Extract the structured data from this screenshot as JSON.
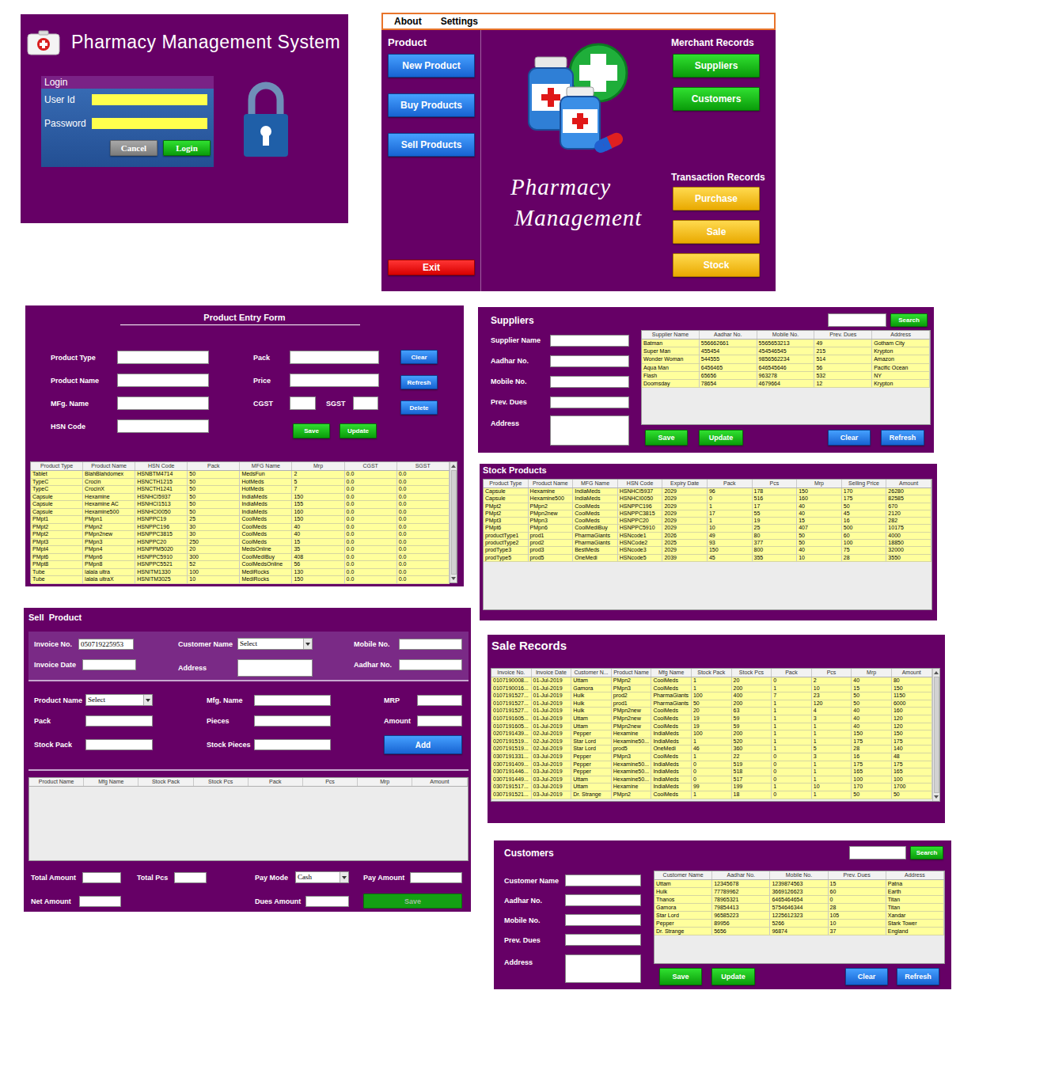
{
  "login": {
    "title": "Pharmacy Management System",
    "box_title": "Login",
    "fields": [
      "User Id",
      "Password"
    ],
    "buttons": [
      "Cancel",
      "Login"
    ]
  },
  "main": {
    "menu": [
      "About",
      "Settings"
    ],
    "product_heading": "Product",
    "product_buttons": [
      "New Product",
      "Buy Products",
      "Sell Products"
    ],
    "exit": "Exit",
    "logo_lines": [
      "Pharmacy",
      "Management"
    ],
    "merchant_heading": "Merchant Records",
    "merchant_buttons": [
      "Suppliers",
      "Customers"
    ],
    "transaction_heading": "Transaction Records",
    "transaction_buttons": [
      "Purchase",
      "Sale",
      "Stock"
    ]
  },
  "product_form": {
    "title": "Product Entry Form",
    "left_fields": [
      "Product Type",
      "Product Name",
      "MFg. Name",
      "HSN Code"
    ],
    "pack": "Pack",
    "price": "Price",
    "cgst": "CGST",
    "sgst": "SGST",
    "side_buttons": [
      "Clear",
      "Refresh",
      "Delete"
    ],
    "buttons": [
      "Save",
      "Update"
    ],
    "table": {
      "columns": [
        "Product Type",
        "Product Name",
        "HSN Code",
        "Pack",
        "MFG Name",
        "Mrp",
        "CGST",
        "SGST"
      ],
      "rows": [
        [
          "Tablet",
          "BlahBlahdomex",
          "HSNBTM4714",
          "50",
          "MedsFun",
          "2",
          "0.0",
          "0.0"
        ],
        [
          "TypeC",
          "Crocin",
          "HSNCTH1215",
          "50",
          "HotMeds",
          "5",
          "0.0",
          "0.0"
        ],
        [
          "TypeC",
          "CrocinX",
          "HSNCTH1241",
          "50",
          "HotMeds",
          "7",
          "0.0",
          "0.0"
        ],
        [
          "Capsule",
          "Hexamine",
          "HSNHCI5937",
          "50",
          "IndiaMeds",
          "150",
          "0.0",
          "0.0"
        ],
        [
          "Capsule",
          "Hexamine AC",
          "HSNHCI1513",
          "50",
          "IndiaMeds",
          "155",
          "0.0",
          "0.0"
        ],
        [
          "Capsule",
          "Hexamine500",
          "HSNHCI0050",
          "50",
          "IndiaMeds",
          "160",
          "0.0",
          "0.0"
        ],
        [
          "PMpt1",
          "PMpn1",
          "HSNPPC19",
          "25",
          "CoolMeds",
          "150",
          "0.0",
          "0.0"
        ],
        [
          "PMpt2",
          "PMpn2",
          "HSNPPC196",
          "30",
          "CoolMeds",
          "40",
          "0.0",
          "0.0"
        ],
        [
          "PMpt2",
          "PMpn2new",
          "HSNPPC3815",
          "30",
          "CoolMeds",
          "40",
          "0.0",
          "0.0"
        ],
        [
          "PMpt3",
          "PMpn3",
          "HSNPPC20",
          "250",
          "CoolMeds",
          "15",
          "0.0",
          "0.0"
        ],
        [
          "PMpt4",
          "PMpn4",
          "HSNPPM5020",
          "20",
          "MedsOnline",
          "35",
          "0.0",
          "0.0"
        ],
        [
          "PMpt6",
          "PMpn6",
          "HSNPPC5910",
          "300",
          "CoolMediBuy",
          "408",
          "0.0",
          "0.0"
        ],
        [
          "PMpt8",
          "PMpn8",
          "HSNPPC5521",
          "52",
          "CoolMedsOnline",
          "56",
          "0.0",
          "0.0"
        ],
        [
          "Tube",
          "lalala ultra",
          "HSNITM1330",
          "100",
          "MediRocks",
          "130",
          "0.0",
          "0.0"
        ],
        [
          "Tube",
          "lalala ultraX",
          "HSNITM3025",
          "10",
          "MediRocks",
          "150",
          "0.0",
          "0.0"
        ]
      ]
    }
  },
  "suppliers": {
    "title": "Suppliers",
    "search_button": "Search",
    "fields": [
      "Supplier Name",
      "Aadhar No.",
      "Mobile No.",
      "Prev. Dues",
      "Address"
    ],
    "buttons": [
      "Save",
      "Update",
      "Clear",
      "Refresh"
    ],
    "table": {
      "columns": [
        "Supplier Name",
        "Aadhar No.",
        "Mobile No.",
        "Prev. Dues",
        "Address"
      ],
      "rows": [
        [
          "Batman",
          "556662661",
          "5565653213",
          "49",
          "Gotham City"
        ],
        [
          "Super Man",
          "455454",
          "454546545",
          "215",
          "Krypton"
        ],
        [
          "Wonder Woman",
          "544555",
          "9856562234",
          "514",
          "Amazon"
        ],
        [
          "Aqua Man",
          "6456465",
          "646545646",
          "56",
          "Pacific Ocean"
        ],
        [
          "Flash",
          "65656",
          "963278",
          "532",
          "NY"
        ],
        [
          "Doomsday",
          "78654",
          "4679664",
          "12",
          "Krypton"
        ]
      ]
    }
  },
  "stock": {
    "title": "Stock Products",
    "table": {
      "columns": [
        "Product Type",
        "Product Name",
        "MFG Name",
        "HSN Code",
        "Expiry Date",
        "Pack",
        "Pcs",
        "Mrp",
        "Selling Price",
        "Amount"
      ],
      "rows": [
        [
          "Capsule",
          "Hexamine",
          "IndiaMeds",
          "HSNHCI5937",
          "2029",
          "96",
          "178",
          "150",
          "170",
          "26280"
        ],
        [
          "Capsule",
          "Hexamine500",
          "IndiaMeds",
          "HSNHCI0050",
          "2029",
          "0",
          "516",
          "160",
          "175",
          "82585"
        ],
        [
          "PMpt2",
          "PMpn2",
          "CoolMeds",
          "HSNPPC196",
          "2029",
          "1",
          "17",
          "40",
          "50",
          "670"
        ],
        [
          "PMpt2",
          "PMpn2new",
          "CoolMeds",
          "HSNPPC3815",
          "2029",
          "17",
          "55",
          "40",
          "45",
          "2120"
        ],
        [
          "PMpt3",
          "PMpn3",
          "CoolMeds",
          "HSNPPC20",
          "2029",
          "1",
          "19",
          "15",
          "16",
          "282"
        ],
        [
          "PMpt6",
          "PMpn6",
          "CoolMediBuy",
          "HSNPPC5910",
          "2029",
          "10",
          "25",
          "407",
          "500",
          "10175"
        ],
        [
          "productType1",
          "prod1",
          "PharmaGiants",
          "HSNcode1",
          "2026",
          "49",
          "80",
          "50",
          "60",
          "4000"
        ],
        [
          "productType2",
          "prod2",
          "PharmaGiants",
          "HSNCode2",
          "2025",
          "93",
          "377",
          "50",
          "100",
          "18850"
        ],
        [
          "prodType3",
          "prod3",
          "BestMeds",
          "HSNcode3",
          "2029",
          "150",
          "800",
          "40",
          "75",
          "32000"
        ],
        [
          "prodType5",
          "prod5",
          "OneMedi",
          "HSNcode5",
          "2039",
          "45",
          "355",
          "10",
          "28",
          "3550"
        ]
      ]
    }
  },
  "sell": {
    "title": "Sell  Product",
    "invoice_no": {
      "label": "Invoice No.",
      "value": "050719225953"
    },
    "customer_name": {
      "label": "Customer Name",
      "value": "Select"
    },
    "mobile": "Mobile No.",
    "invoice_date": "Invoice Date",
    "address": "Address",
    "aadhar": "Aadhar No.",
    "product_name": {
      "label": "Product Name",
      "value": "Select"
    },
    "mfg": "Mfg. Name",
    "mrp": "MRP",
    "pack": "Pack",
    "pieces": "Pieces",
    "amount": "Amount",
    "stock_pack": "Stock Pack",
    "stock_pieces": "Stock Pieces",
    "add": "Add",
    "table": {
      "columns": [
        "Product Name",
        "Mfg Name",
        "Stock Pack",
        "Stock Pcs",
        "Pack",
        "Pcs",
        "Mrp",
        "Amount"
      ],
      "rows": []
    },
    "total_amount": "Total Amount",
    "total_pcs": "Total Pcs",
    "pay_mode": {
      "label": "Pay Mode",
      "value": "Cash"
    },
    "pay_amount": "Pay Amount",
    "net_amount": "Net Amount",
    "dues_amount": "Dues Amount",
    "save": {
      "label": "Save",
      "disabled": true
    }
  },
  "sales": {
    "title": "Sale Records",
    "table": {
      "columns": [
        "Invoice No.",
        "Invoice Date",
        "Customer N...",
        "Product Name",
        "Mfg Name",
        "Stock Pack",
        "Stock Pcs",
        "Pack",
        "Pcs",
        "Mrp",
        "Amount"
      ],
      "rows": [
        [
          "0107190008...",
          "01-Jul-2019",
          "Uttam",
          "PMpn2",
          "CoolMeds",
          "1",
          "20",
          "0",
          "2",
          "40",
          "80"
        ],
        [
          "0107190016...",
          "01-Jul-2019",
          "Gamora",
          "PMpn3",
          "CoolMeds",
          "1",
          "200",
          "1",
          "10",
          "15",
          "150"
        ],
        [
          "0107191527...",
          "01-Jul-2019",
          "Hulk",
          "prod2",
          "PharmaGiants",
          "100",
          "400",
          "7",
          "23",
          "50",
          "1150"
        ],
        [
          "0107191527...",
          "01-Jul-2019",
          "Hulk",
          "prod1",
          "PharmaGiants",
          "50",
          "200",
          "1",
          "120",
          "50",
          "6000"
        ],
        [
          "0107191527...",
          "01-Jul-2019",
          "Hulk",
          "PMpn2new",
          "CoolMeds",
          "20",
          "63",
          "1",
          "4",
          "40",
          "160"
        ],
        [
          "0107191605...",
          "01-Jul-2019",
          "Uttam",
          "PMpn2new",
          "CoolMeds",
          "19",
          "59",
          "1",
          "3",
          "40",
          "120"
        ],
        [
          "0107191605...",
          "01-Jul-2019",
          "Uttam",
          "PMpn2new",
          "CoolMeds",
          "19",
          "59",
          "1",
          "1",
          "40",
          "120"
        ],
        [
          "0207191439...",
          "02-Jul-2019",
          "Pepper",
          "Hexamine",
          "IndiaMeds",
          "100",
          "200",
          "1",
          "1",
          "150",
          "150"
        ],
        [
          "0207191519...",
          "02-Jul-2019",
          "Star Lord",
          "Hexamine50...",
          "IndiaMeds",
          "1",
          "520",
          "1",
          "1",
          "175",
          "175"
        ],
        [
          "0207191519...",
          "02-Jul-2019",
          "Star Lord",
          "prod5",
          "OneMedi",
          "46",
          "360",
          "1",
          "5",
          "28",
          "140"
        ],
        [
          "0307191331...",
          "03-Jul-2019",
          "Pepper",
          "PMpn3",
          "CoolMeds",
          "1",
          "22",
          "0",
          "3",
          "16",
          "48"
        ],
        [
          "0307191409...",
          "03-Jul-2019",
          "Pepper",
          "Hexamine50...",
          "IndiaMeds",
          "0",
          "519",
          "0",
          "1",
          "175",
          "175"
        ],
        [
          "0307191446...",
          "03-Jul-2019",
          "Pepper",
          "Hexamine50...",
          "IndiaMeds",
          "0",
          "518",
          "0",
          "1",
          "165",
          "165"
        ],
        [
          "0307191449...",
          "03-Jul-2019",
          "Uttam",
          "Hexamine50...",
          "IndiaMeds",
          "0",
          "517",
          "0",
          "1",
          "100",
          "100"
        ],
        [
          "0307191517...",
          "03-Jul-2019",
          "Uttam",
          "Hexamine",
          "IndiaMeds",
          "99",
          "199",
          "1",
          "10",
          "170",
          "1700"
        ],
        [
          "0307191521...",
          "03-Jul-2019",
          "Dr. Strange",
          "PMpn2",
          "CoolMeds",
          "1",
          "18",
          "0",
          "1",
          "50",
          "50"
        ]
      ]
    }
  },
  "customers": {
    "title": "Customers",
    "search_button": "Search",
    "fields": [
      "Customer Name",
      "Aadhar No.",
      "Mobile No.",
      "Prev. Dues",
      "Address"
    ],
    "buttons": [
      "Save",
      "Update",
      "Clear",
      "Refresh"
    ],
    "table": {
      "columns": [
        "Customer Name",
        "Aadhar No.",
        "Mobile No.",
        "Prev. Dues",
        "Address"
      ],
      "rows": [
        [
          "Uttam",
          "12345678",
          "1239874563",
          "15",
          "Patna"
        ],
        [
          "Hulk",
          "77789962",
          "3669126623",
          "60",
          "Earth"
        ],
        [
          "Thanos",
          "78965321",
          "6465464654",
          "0",
          "Titan"
        ],
        [
          "Gamora",
          "79854413",
          "5754646344",
          "28",
          "Titan"
        ],
        [
          "Star Lord",
          "96585223",
          "1225612323",
          "105",
          "Xandar"
        ],
        [
          "Pepper",
          "89956",
          "5266",
          "10",
          "Stark Tower"
        ],
        [
          "Dr. Strange",
          "5656",
          "96874",
          "37",
          "England"
        ]
      ]
    }
  }
}
